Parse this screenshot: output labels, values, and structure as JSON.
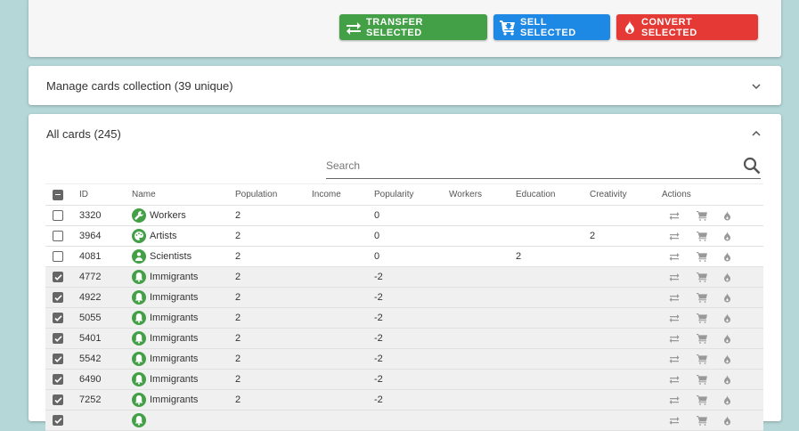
{
  "toolbar": {
    "transfer_label": "TRANSFER SELECTED",
    "sell_label": "SELL SELECTED",
    "convert_label": "CONVERT SELECTED"
  },
  "manage_panel": {
    "title": "Manage cards collection (39 unique)"
  },
  "cards_panel": {
    "title": "All cards (245)"
  },
  "search": {
    "placeholder": "Search"
  },
  "table": {
    "columns": [
      "ID",
      "Name",
      "Population",
      "Income",
      "Popularity",
      "Workers",
      "Education",
      "Creativity",
      "Actions"
    ],
    "rows": [
      {
        "selected": false,
        "id": "3320",
        "name": "Workers",
        "icon": "wrench-icon",
        "population": "2",
        "income": "",
        "popularity": "0",
        "workers": "",
        "education": "",
        "creativity": ""
      },
      {
        "selected": false,
        "id": "3964",
        "name": "Artists",
        "icon": "palette-icon",
        "population": "2",
        "income": "",
        "popularity": "0",
        "workers": "",
        "education": "",
        "creativity": "2"
      },
      {
        "selected": false,
        "id": "4081",
        "name": "Scientists",
        "icon": "person-icon",
        "population": "2",
        "income": "",
        "popularity": "0",
        "workers": "",
        "education": "2",
        "creativity": ""
      },
      {
        "selected": true,
        "id": "4772",
        "name": "Immigrants",
        "icon": "bell-icon",
        "population": "2",
        "income": "",
        "popularity": "-2",
        "workers": "",
        "education": "",
        "creativity": ""
      },
      {
        "selected": true,
        "id": "4922",
        "name": "Immigrants",
        "icon": "bell-icon",
        "population": "2",
        "income": "",
        "popularity": "-2",
        "workers": "",
        "education": "",
        "creativity": ""
      },
      {
        "selected": true,
        "id": "5055",
        "name": "Immigrants",
        "icon": "bell-icon",
        "population": "2",
        "income": "",
        "popularity": "-2",
        "workers": "",
        "education": "",
        "creativity": ""
      },
      {
        "selected": true,
        "id": "5401",
        "name": "Immigrants",
        "icon": "bell-icon",
        "population": "2",
        "income": "",
        "popularity": "-2",
        "workers": "",
        "education": "",
        "creativity": ""
      },
      {
        "selected": true,
        "id": "5542",
        "name": "Immigrants",
        "icon": "bell-icon",
        "population": "2",
        "income": "",
        "popularity": "-2",
        "workers": "",
        "education": "",
        "creativity": ""
      },
      {
        "selected": true,
        "id": "6490",
        "name": "Immigrants",
        "icon": "bell-icon",
        "population": "2",
        "income": "",
        "popularity": "-2",
        "workers": "",
        "education": "",
        "creativity": ""
      },
      {
        "selected": true,
        "id": "7252",
        "name": "Immigrants",
        "icon": "bell-icon",
        "population": "2",
        "income": "",
        "popularity": "-2",
        "workers": "",
        "education": "",
        "creativity": ""
      },
      {
        "selected": true,
        "id": "",
        "name": "",
        "icon": "bell-icon",
        "population": "",
        "income": "",
        "popularity": "",
        "workers": "",
        "education": "",
        "creativity": ""
      }
    ]
  },
  "colors": {
    "transfer": "#43a047",
    "sell": "#1e88e5",
    "convert": "#e53935",
    "name_icon_bg": "#43a047",
    "background": "#b5d7d8"
  }
}
